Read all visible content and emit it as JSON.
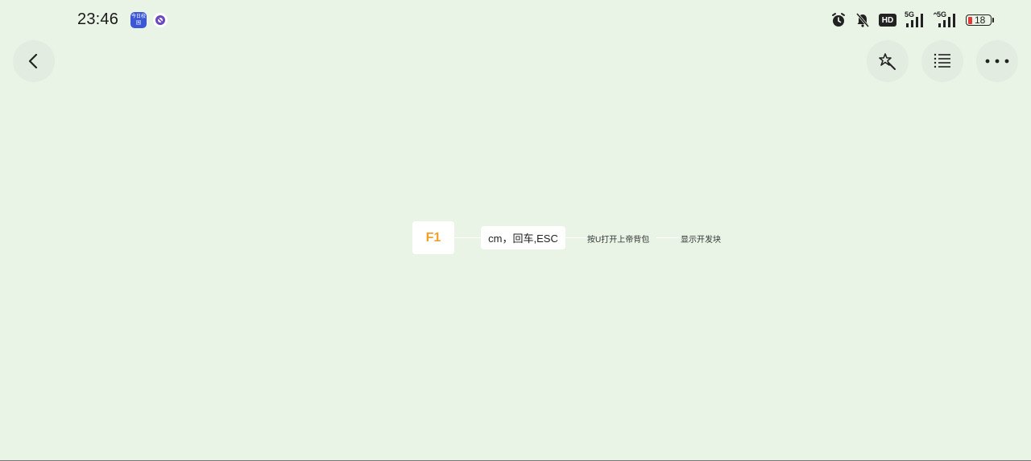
{
  "status_bar": {
    "time": "23:46",
    "news_app_label": "今日校园",
    "battery_level": "18",
    "network_1": "5G",
    "network_2": "5G",
    "hd_label": "HD",
    "icons": [
      "news-app-icon",
      "circle-app-icon",
      "alarm-icon",
      "mute-bell-icon",
      "hd-icon",
      "signal-5g-icon",
      "signal-5g-icon",
      "battery-icon"
    ]
  },
  "toolbar": {
    "back": "back-arrow-icon",
    "pen": "magic-pen-icon",
    "outline": "list-icon",
    "more": "more-dots-icon"
  },
  "mindmap": {
    "root": "F1",
    "level1": "cm，回车,ESC",
    "level2": "按U打开上帝背包",
    "level3": "显示开发块"
  },
  "colors": {
    "background": "#e9f4e6",
    "root_text": "#f0a12a",
    "battery_low": "#e03a3a"
  }
}
